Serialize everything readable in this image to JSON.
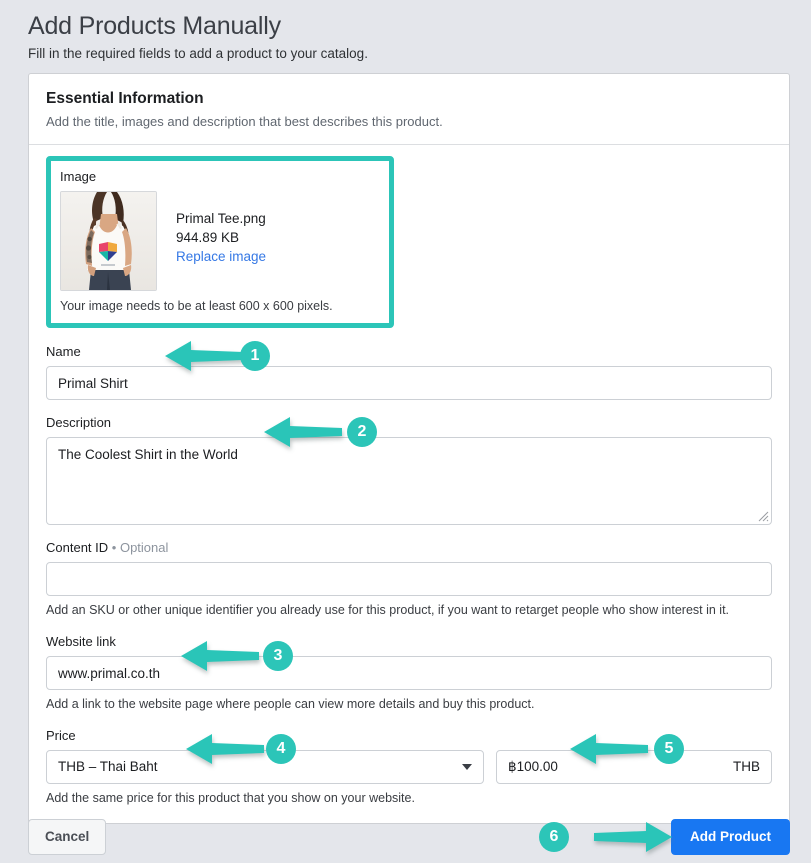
{
  "header": {
    "title": "Add Products Manually",
    "subtitle": "Fill in the required fields to add a product to your catalog."
  },
  "card": {
    "heading": "Essential Information",
    "subheading": "Add the title, images and description that best describes this product."
  },
  "image_field": {
    "label": "Image",
    "file_name": "Primal Tee.png",
    "file_size": "944.89 KB",
    "replace_link": "Replace image",
    "hint": "Your image needs to be at least 600 x 600 pixels.",
    "highlight_color": "#2cc5b8"
  },
  "name_field": {
    "label": "Name",
    "value": "Primal Shirt",
    "placeholder": ""
  },
  "description_field": {
    "label": "Description",
    "value": "The Coolest Shirt in the World",
    "placeholder": ""
  },
  "content_id_field": {
    "label": "Content ID",
    "separator": "•",
    "optional": "Optional",
    "value": "",
    "placeholder": "",
    "helper": "Add an SKU or other unique identifier you already use for this product, if you want to retarget people who show interest in it."
  },
  "website_field": {
    "label": "Website link",
    "value": "www.primal.co.th",
    "placeholder": "",
    "helper": "Add a link to the website page where people can view more details and buy this product."
  },
  "price_field": {
    "label": "Price",
    "currency_value": "THB – Thai Baht",
    "amount_value": "฿100.00",
    "currency_suffix": "THB",
    "helper": "Add the same price for this product that you show on your website."
  },
  "footer": {
    "cancel_label": "Cancel",
    "submit_label": "Add Product",
    "submit_color": "#1877f2"
  },
  "annotations": {
    "accent_color": "#2cc5b8",
    "steps": [
      {
        "number": "1",
        "target": "name-input",
        "direction": "left"
      },
      {
        "number": "2",
        "target": "description-textarea",
        "direction": "left"
      },
      {
        "number": "3",
        "target": "website-link-input",
        "direction": "left"
      },
      {
        "number": "4",
        "target": "currency-select",
        "direction": "left"
      },
      {
        "number": "5",
        "target": "price-amount-input",
        "direction": "left"
      },
      {
        "number": "6",
        "target": "add-product-button",
        "direction": "right"
      }
    ]
  }
}
